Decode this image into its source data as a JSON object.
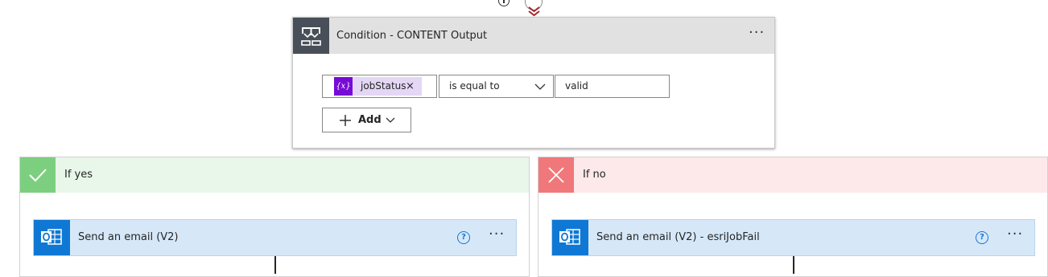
{
  "condition": {
    "title": "Condition - CONTENT Output",
    "menu_label": "···",
    "header_icon": "condition-icon",
    "row": {
      "token_icon_text": "{x}",
      "token_label": "jobStatus",
      "token_remove": "×",
      "operator": "is equal to",
      "value": "valid"
    },
    "add_label": "Add"
  },
  "branches": {
    "yes": {
      "label": "If yes",
      "color": "#7ccf7f",
      "action": {
        "title": "Send an email (V2)",
        "help": "?",
        "menu_label": "···"
      }
    },
    "no": {
      "label": "If no",
      "color": "#f0787a",
      "action": {
        "title": "Send an email (V2) - esriJobFail",
        "help": "?",
        "menu_label": "···"
      }
    }
  },
  "icons": {
    "condition": "condition-icon",
    "check": "check-icon",
    "close": "close-icon",
    "outlook": "outlook-icon",
    "help": "help-icon",
    "chevron": "chevron-down-icon"
  }
}
